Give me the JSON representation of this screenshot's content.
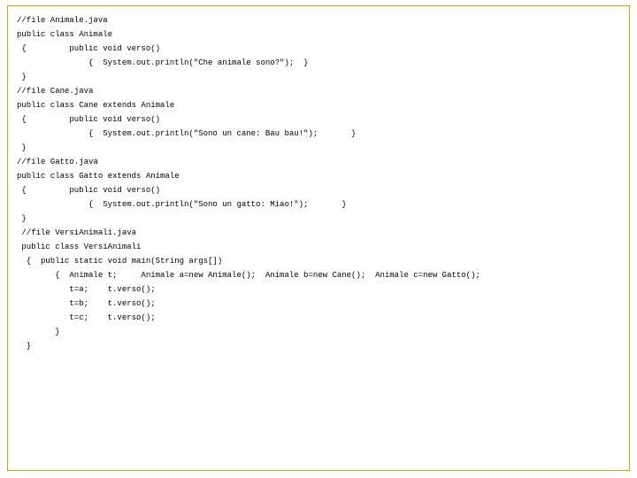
{
  "code": {
    "lines": [
      "//file Animale.java",
      "public class Animale",
      " {         public void verso()",
      "               {  System.out.println(\"Che animale sono?\");  }",
      " }",
      "//file Cane.java",
      "public class Cane extends Animale",
      " {         public void verso()",
      "               {  System.out.println(\"Sono un cane: Bau bau!\");       }",
      " }",
      "//file Gatto.java",
      "public class Gatto extends Animale",
      " {         public void verso()",
      "               {  System.out.println(\"Sono un gatto: Miao!\");       }",
      " }",
      " //file VersiAnimali.java",
      " public class VersiAnimali",
      "  {  public static void main(String args[])",
      "        {  Animale t;     Animale a=new Animale();  Animale b=new Cane();  Animale c=new Gatto();",
      "           t=a;    t.verso();",
      "           t=b;    t.verso();",
      "           t=c;    t.verso();",
      "        }",
      "  }"
    ]
  }
}
